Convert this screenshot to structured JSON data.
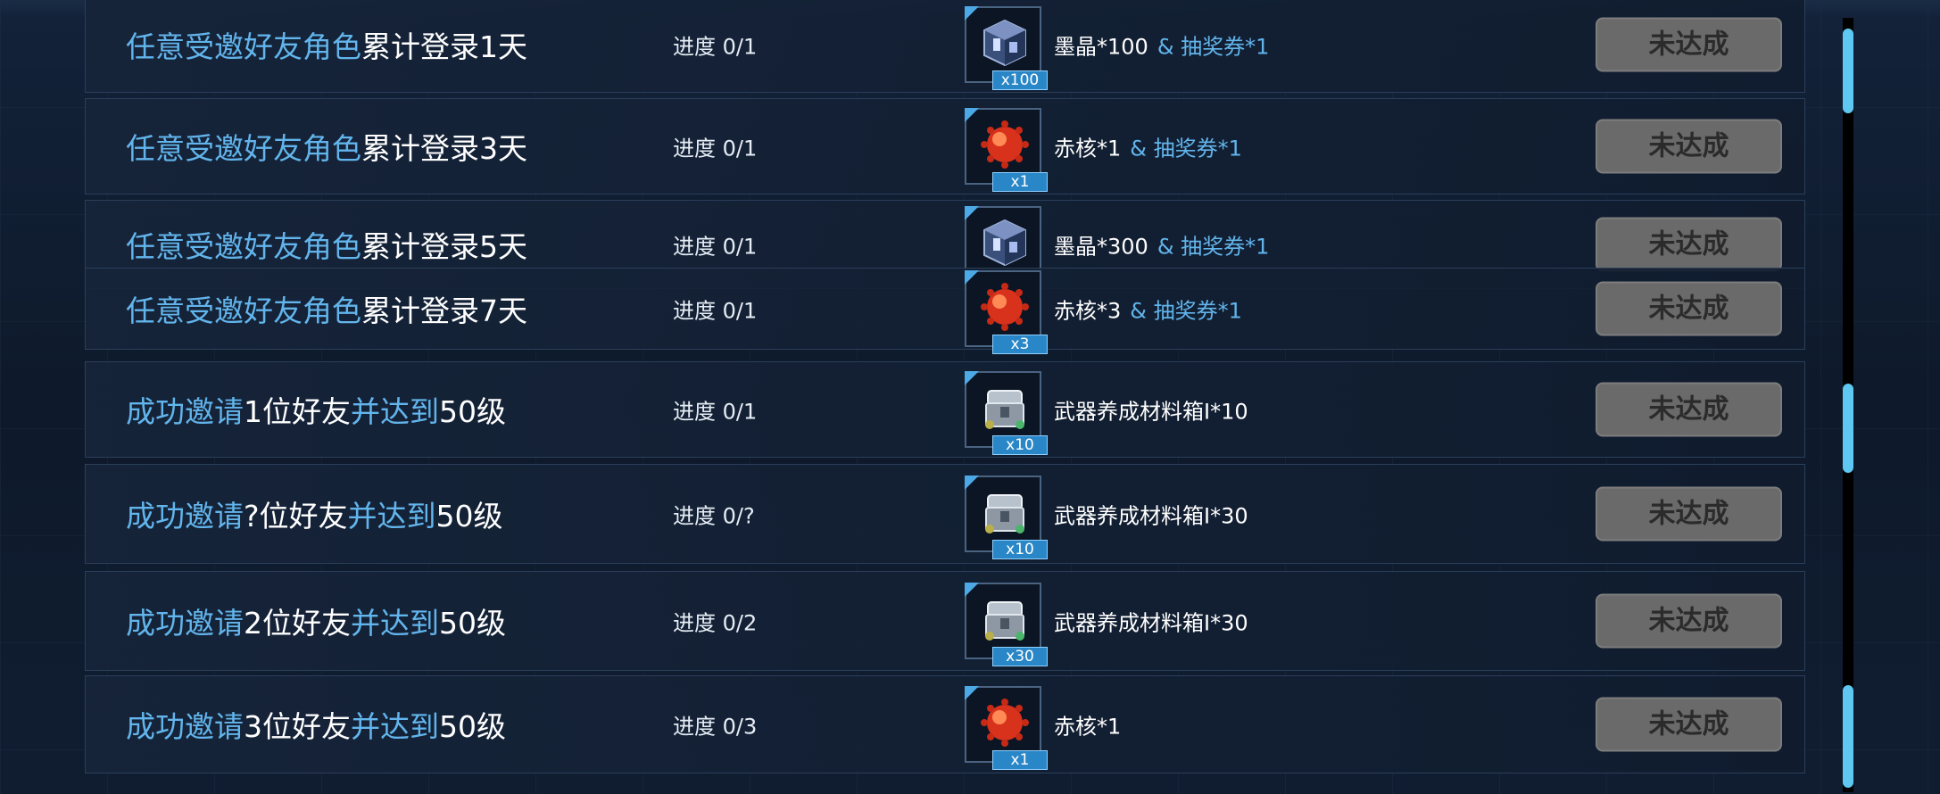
{
  "button_label": "未达成",
  "rows": [
    {
      "title_parts": [
        {
          "t": "任意受邀好友角色",
          "c": "hl"
        },
        {
          "t": "累计登录1天",
          "c": "nm"
        }
      ],
      "progress": "进度 0/1",
      "icon": "ink-crystal-cube-icon",
      "qty": "x100",
      "reward": "墨晶*100",
      "extra": "& 抽奖券*1"
    },
    {
      "title_parts": [
        {
          "t": "任意受邀好友角色",
          "c": "hl"
        },
        {
          "t": "累计登录3天",
          "c": "nm"
        }
      ],
      "progress": "进度 0/1",
      "icon": "red-core-orb-icon",
      "qty": "x1",
      "reward": "赤核*1",
      "extra": "& 抽奖券*1"
    },
    {
      "title_parts": [
        {
          "t": "任意受邀好友角色",
          "c": "hl"
        },
        {
          "t": "累计登录5天",
          "c": "nm"
        }
      ],
      "progress": "进度 0/1",
      "icon": "ink-crystal-cube-icon",
      "qty": "",
      "reward": "墨晶*300",
      "extra": "& 抽奖券*1"
    },
    {
      "title_parts": [
        {
          "t": "任意受邀好友角色",
          "c": "hl"
        },
        {
          "t": "累计登录7天",
          "c": "nm"
        }
      ],
      "progress": "进度 0/1",
      "icon": "red-core-orb-icon",
      "qty": "x3",
      "reward": "赤核*3",
      "extra": "& 抽奖券*1"
    },
    {
      "title_parts": [
        {
          "t": "成功邀请",
          "c": "hl"
        },
        {
          "t": "1位好友",
          "c": "nm"
        },
        {
          "t": "并达到",
          "c": "hl"
        },
        {
          "t": "50级",
          "c": "nm"
        }
      ],
      "progress": "进度 0/1",
      "icon": "weapon-material-chest-icon",
      "qty": "x10",
      "reward": "武器养成材料箱I*10",
      "extra": ""
    },
    {
      "title_parts": [
        {
          "t": "成功邀请",
          "c": "hl"
        },
        {
          "t": "?位好友",
          "c": "nm"
        },
        {
          "t": "并达到",
          "c": "hl"
        },
        {
          "t": "50级",
          "c": "nm"
        }
      ],
      "progress": "进度 0/?",
      "icon": "weapon-material-chest-icon",
      "qty": "x10",
      "reward": "武器养成材料箱I*30",
      "extra": ""
    },
    {
      "title_parts": [
        {
          "t": "成功邀请",
          "c": "hl"
        },
        {
          "t": "2位好友",
          "c": "nm"
        },
        {
          "t": "并达到",
          "c": "hl"
        },
        {
          "t": "50级",
          "c": "nm"
        }
      ],
      "progress": "进度 0/2",
      "icon": "weapon-material-chest-icon",
      "qty": "x30",
      "reward": "武器养成材料箱I*30",
      "extra": ""
    },
    {
      "title_parts": [
        {
          "t": "成功邀请",
          "c": "hl"
        },
        {
          "t": "3位好友",
          "c": "nm"
        },
        {
          "t": "并达到",
          "c": "hl"
        },
        {
          "t": "50级",
          "c": "nm"
        }
      ],
      "progress": "进度 0/3",
      "icon": "red-core-orb-icon",
      "qty": "x1",
      "reward": "赤核*1",
      "extra": ""
    }
  ]
}
